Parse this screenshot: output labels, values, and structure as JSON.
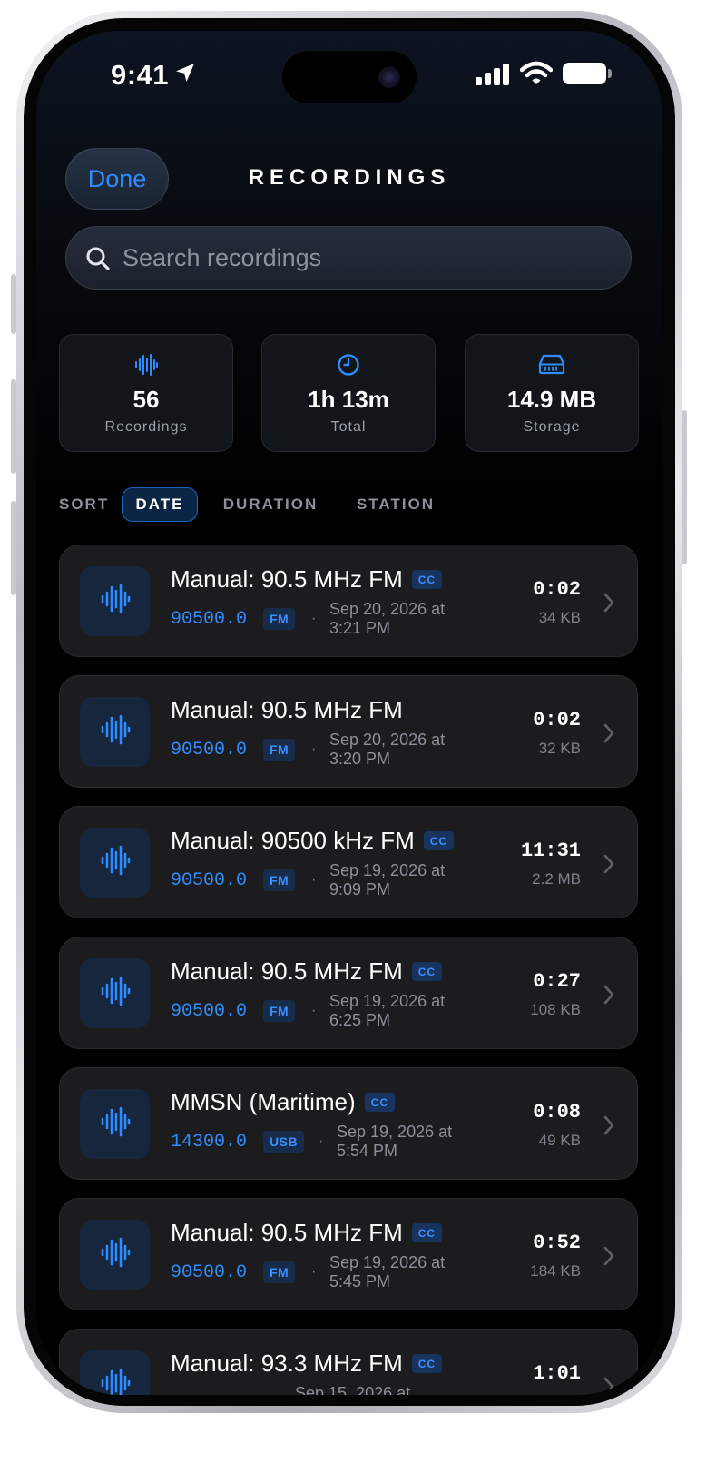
{
  "status_bar": {
    "time": "9:41"
  },
  "header": {
    "done_label": "Done",
    "title": "RECORDINGS"
  },
  "search": {
    "placeholder": "Search recordings",
    "value": ""
  },
  "stats": [
    {
      "icon": "waveform-icon",
      "value": "56",
      "label": "Recordings"
    },
    {
      "icon": "clock-icon",
      "value": "1h 13m",
      "label": "Total"
    },
    {
      "icon": "drive-icon",
      "value": "14.9 MB",
      "label": "Storage"
    }
  ],
  "sort": {
    "label": "SORT",
    "options": [
      "DATE",
      "DURATION",
      "STATION"
    ],
    "active": "DATE"
  },
  "recordings": [
    {
      "name": "Manual: 90.5 MHz FM",
      "cc": "CC",
      "freq": "90500.0",
      "mode": "FM",
      "date_line1": "Sep 20, 2026 at",
      "date_line2": "3:21 PM",
      "duration": "0:02",
      "size": "34 KB"
    },
    {
      "name": "Manual: 90.5 MHz FM",
      "cc": "",
      "freq": "90500.0",
      "mode": "FM",
      "date_line1": "Sep 20, 2026 at",
      "date_line2": "3:20 PM",
      "duration": "0:02",
      "size": "32 KB"
    },
    {
      "name": "Manual: 90500 kHz FM",
      "cc": "CC",
      "freq": "90500.0",
      "mode": "FM",
      "date_line1": "Sep 19, 2026 at",
      "date_line2": "9:09 PM",
      "duration": "11:31",
      "size": "2.2 MB"
    },
    {
      "name": "Manual: 90.5 MHz FM",
      "cc": "CC",
      "freq": "90500.0",
      "mode": "FM",
      "date_line1": "Sep 19, 2026 at",
      "date_line2": "6:25 PM",
      "duration": "0:27",
      "size": "108 KB"
    },
    {
      "name": "MMSN (Maritime)",
      "cc": "CC",
      "freq": "14300.0",
      "mode": "USB",
      "date_line1": "Sep 19, 2026 at",
      "date_line2": "5:54 PM",
      "duration": "0:08",
      "size": "49 KB"
    },
    {
      "name": "Manual: 90.5 MHz FM",
      "cc": "CC",
      "freq": "90500.0",
      "mode": "FM",
      "date_line1": "Sep 19, 2026 at",
      "date_line2": "5:45 PM",
      "duration": "0:52",
      "size": "184 KB"
    },
    {
      "name": "Manual: 93.3 MHz FM",
      "cc": "CC",
      "freq": "",
      "mode": "",
      "date_line1": "Sep 15, 2026 at",
      "date_line2": "",
      "duration": "1:01",
      "size": ""
    }
  ],
  "colors": {
    "accent": "#2e8cff",
    "background": "#000000",
    "card": "#1c1c1e"
  }
}
